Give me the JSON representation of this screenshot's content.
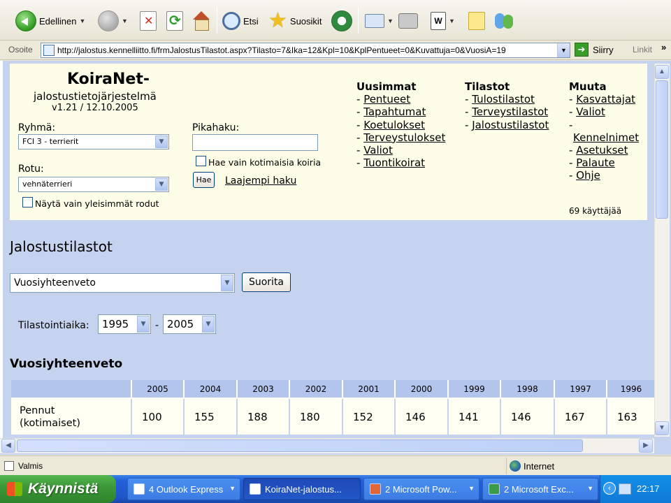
{
  "browser": {
    "toolbar": {
      "back_label": "Edellinen",
      "search_label": "Etsi",
      "favorites_label": "Suosikit"
    },
    "address": {
      "label": "Osoite",
      "url": "http://jalostus.kennelliitto.fi/frmJalostusTilastot.aspx?Tilasto=7&Ika=12&Kpl=10&KplPentueet=0&Kuvattuja=0&VuosiA=19",
      "go_label": "Siirry",
      "links_label": "Linkit",
      "more": "»"
    },
    "status": {
      "text": "Valmis",
      "zone": "Internet"
    }
  },
  "app": {
    "title": "KoiraNet-",
    "subtitle": "jalostustietojärjestelmä",
    "version": "v1.21 / 12.10.2005"
  },
  "filters": {
    "group_label": "Ryhmä:",
    "group_value": "FCI 3 - terrierit",
    "breed_label": "Rotu:",
    "breed_value": "vehnäterrieri",
    "common_only_label": "Näytä vain yleisimmät rodut",
    "quick_search_label": "Pikahaku:",
    "domestic_only_label": "Hae vain kotimaisia koiria",
    "search_button": "Hae",
    "advanced_search_link": "Laajempi haku"
  },
  "nav": {
    "newest": {
      "heading": "Uusimmat",
      "items": [
        "Pentueet",
        "Tapahtumat",
        "Koetulokset",
        "Terveystulokset",
        "Valiot",
        "Tuontikoirat"
      ]
    },
    "stats": {
      "heading": "Tilastot",
      "items": [
        "Tulostilastot",
        "Terveystilastot",
        "Jalostustilastot"
      ]
    },
    "other": {
      "heading": "Muuta",
      "items": [
        "Kasvattajat",
        "Valiot",
        "Kennelnimet",
        "Asetukset",
        "Palaute",
        "Ohje"
      ]
    },
    "users": "69 käyttäjää"
  },
  "main": {
    "section_title": "Jalostustilastot",
    "report_select": "Vuosiyhteenveto",
    "run_button": "Suorita",
    "period_label": "Tilastointiaika:",
    "period_from": "1995",
    "period_separator": "-",
    "period_to": "2005",
    "summary_title": "Vuosiyhteenveto"
  },
  "table": {
    "years": [
      "2005",
      "2004",
      "2003",
      "2002",
      "2001",
      "2000",
      "1999",
      "1998",
      "1997",
      "1996"
    ],
    "rows": [
      {
        "label_line1": "Pennut",
        "label_line2": "(kotimaiset)",
        "values": [
          "100",
          "155",
          "188",
          "180",
          "152",
          "146",
          "141",
          "146",
          "167",
          "163"
        ]
      }
    ]
  },
  "taskbar": {
    "start_label": "Käynnistä",
    "tasks": [
      "4 Outlook Express",
      "KoiraNet-jalostus...",
      "2 Microsoft Pow...",
      "2 Microsoft Exc..."
    ],
    "clock": "22:17"
  }
}
